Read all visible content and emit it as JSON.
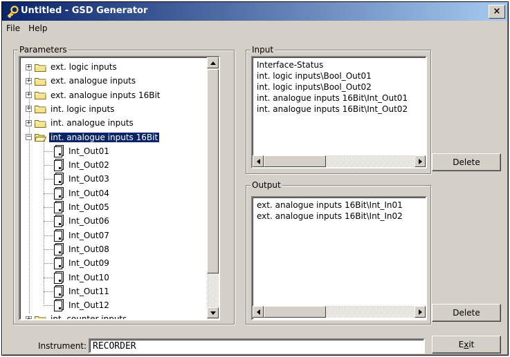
{
  "window": {
    "title": "Untitled - GSD Generator",
    "close_glyph": "×"
  },
  "menu": [
    "File",
    "Help"
  ],
  "parameters": {
    "label": "Parameters",
    "folders": [
      "ext. logic inputs",
      "ext. analogue inputs",
      "ext. analogue inputs 16Bit",
      "int. logic inputs",
      "int. analogue inputs",
      "int. analogue inputs 16Bit"
    ],
    "selected": "int. analogue inputs 16Bit",
    "children": [
      "Int_Out01",
      "Int_Out02",
      "Int_Out03",
      "Int_Out04",
      "Int_Out05",
      "Int_Out06",
      "Int_Out07",
      "Int_Out08",
      "Int_Out09",
      "Int_Out10",
      "Int_Out11",
      "Int_Out12"
    ],
    "partial_folder": "int. counter inputs"
  },
  "input": {
    "label": "Input",
    "items": [
      "Interface-Status",
      "int. logic inputs\\Bool_Out01",
      "int. logic inputs\\Bool_Out02",
      "int. analogue inputs 16Bit\\Int_Out01",
      "int. analogue inputs 16Bit\\Int_Out02"
    ],
    "delete_label": "Delete"
  },
  "output": {
    "label": "Output",
    "items": [
      "ext. analogue inputs 16Bit\\Int_In01",
      "ext. analogue inputs 16Bit\\Int_In02"
    ],
    "delete_label": "Delete"
  },
  "instrument": {
    "label": "Instrument:",
    "value": "RECORDER"
  },
  "exit": {
    "label_pre": "E",
    "label_u": "x",
    "label_post": "it"
  },
  "colors": {
    "title_start": "#0a246a",
    "title_end": "#a6caf0",
    "face": "#d4d0c8",
    "selection": "#0a246a"
  }
}
